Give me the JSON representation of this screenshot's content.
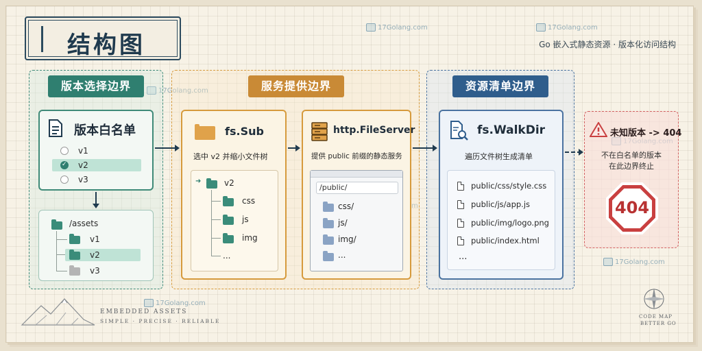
{
  "title": "结构图",
  "subtitle": "Go 嵌入式静态资源 · 版本化访问结构",
  "watermark": "17Golang.com",
  "sections": {
    "version": {
      "label": "版本选择边界",
      "whitelist_title": "版本白名单",
      "versions": [
        "v1",
        "v2",
        "v3"
      ],
      "selected": "v2",
      "assets_root": "/assets",
      "assets_children": [
        "v1",
        "v2",
        "v3"
      ]
    },
    "serve": {
      "label": "服务提供边界",
      "sub_title": "fs.Sub",
      "sub_desc": "选中 v2 并缩小文件树",
      "sub_tree_root": "v2",
      "sub_tree_children": [
        "css",
        "js",
        "img",
        "..."
      ],
      "fileserver_title": "http.FileServer",
      "fileserver_desc": "提供 public 前缀的静态服务",
      "url": "/public/",
      "browser_items": [
        "css/",
        "js/",
        "img/",
        "..."
      ]
    },
    "manifest": {
      "label": "资源清单边界",
      "walk_title": "fs.WalkDir",
      "walk_desc": "遍历文件树生成清单",
      "files": [
        "public/css/style.css",
        "public/js/app.js",
        "public/img/logo.png",
        "public/index.html"
      ],
      "more": "..."
    },
    "unknown": {
      "title": "未知版本 -> 404",
      "desc_line1": "不在白名单的版本",
      "desc_line2": "在此边界终止",
      "code": "404"
    }
  },
  "footer": {
    "left_line1": "EMBEDDED ASSETS",
    "left_line2": "SIMPLE · PRECISE · RELIABLE",
    "right_line1": "CODE MAP",
    "right_line2": "BETTER GO"
  },
  "colors": {
    "navy": "#1f3a4e",
    "green": "#2f7f70",
    "orange": "#c98a36",
    "blue": "#2f5d8c",
    "red": "#c94040"
  }
}
